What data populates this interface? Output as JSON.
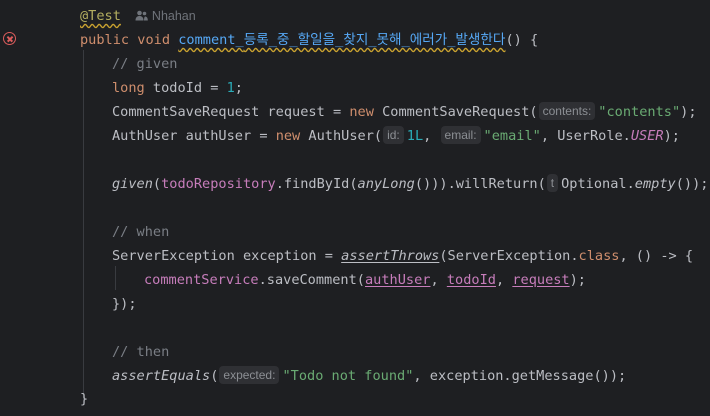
{
  "editor": {
    "author": "Nhahan",
    "annotation": "@Test",
    "lines": {
      "l1": {
        "public": "public",
        "void": "void",
        "name_en": "comment_",
        "name_ko": "등록_중_할일을_찾지_못해_에러가_발생한다",
        "tail": "() {"
      },
      "l2": {
        "comment": "// given"
      },
      "l3": {
        "type": "long",
        "var": " todoId = ",
        "num": "1",
        "end": ";"
      },
      "l4": {
        "type": "CommentSaveRequest request = ",
        "new": "new",
        "cls": " CommentSaveRequest(",
        "hint": "contents:",
        "str": "\"contents\"",
        "end": ");"
      },
      "l5": {
        "type": "AuthUser authUser = ",
        "new": "new",
        "cls": " AuthUser(",
        "hint1": "id:",
        "num": "1L",
        "sep": ", ",
        "hint2": "email:",
        "str": "\"email\"",
        "mid": ", UserRole.",
        "enum": "USER",
        "end": ");"
      },
      "l6": {
        "given": "given",
        "p1": "(",
        "repo": "todoRepository",
        "p2": ".findById(",
        "any": "anyLong",
        "p3": "())).willReturn(",
        "hint": "t",
        "opt": "Optional.",
        "empty": "empty",
        "end": "());"
      },
      "l7": {
        "comment": "// when"
      },
      "l8": {
        "a": "ServerException exception = ",
        "assert": "assertThrows",
        "b": "(ServerException.",
        "cls": "class",
        "c": ", () -> {"
      },
      "l9": {
        "svc": "commentService",
        "a": ".saveComment(",
        "u": "authUser",
        "s1": ", ",
        "t": "todoId",
        "s2": ", ",
        "r": "request",
        "end": ");"
      },
      "l10": {
        "text": "});"
      },
      "l11": {
        "comment": "// then"
      },
      "l12": {
        "fn": "assertEquals",
        "p": "(",
        "hint": "expected:",
        "str": "\"Todo not found\"",
        "end": ", exception.getMessage());"
      },
      "l13": {
        "text": "}"
      }
    }
  },
  "colors": {
    "background": "#1e1f22",
    "keyword": "#cf8e6d",
    "function": "#56a8f5",
    "string": "#6aab73",
    "number": "#2aacb8",
    "comment": "#7a7e85",
    "field": "#c77dbb",
    "annotation": "#b3ae60",
    "error": "#db5c5c"
  },
  "icons": {
    "gutter_error": "error-circle-icon",
    "author": "user-icon"
  }
}
